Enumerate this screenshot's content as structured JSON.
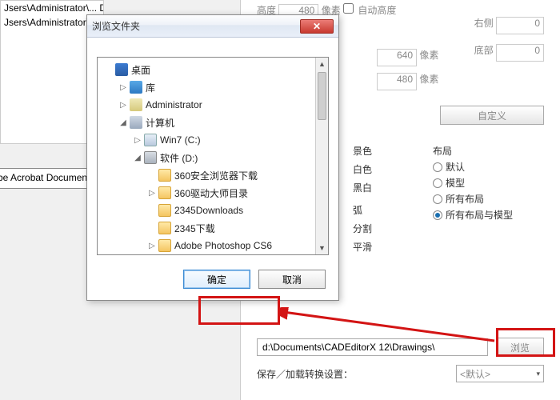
{
  "bg": {
    "pathRows": [
      "Jsers\\Administrator\\...   DWG",
      "Jsers\\Administrator\\...",
      ""
    ],
    "acrobat": "be Acrobat Documen",
    "heightLabel": "高度",
    "heightVal": "480",
    "px": "像素",
    "autoHeight": "自动高度",
    "rightLabel": "右侧",
    "rightVal": "0",
    "bottomLabel": "底部",
    "bottomVal": "0",
    "box640": "640",
    "box480": "480",
    "customBtn": "自定义",
    "colorTitle": "景色",
    "colorWhite": "白色",
    "colorBW": "黑白",
    "layoutTitle": "布局",
    "layoutDefault": "默认",
    "layoutModel": "模型",
    "layoutAll": "所有布局",
    "layoutAllModel": "所有布局与模型",
    "arcTitle": "弧",
    "arcSplit": "分割",
    "arcSmooth": "平滑",
    "outPath": "d:\\Documents\\CADEditorX 12\\Drawings\\",
    "browse": "浏览",
    "saveLoad": "保存／加载转换设置：",
    "defaultOpt": "<默认>"
  },
  "dialog": {
    "title": "浏览文件夹",
    "ok": "确定",
    "cancel": "取消",
    "tree": [
      {
        "indent": 0,
        "exp": "",
        "icon": "desktop",
        "label": "桌面"
      },
      {
        "indent": 1,
        "exp": "▷",
        "icon": "lib",
        "label": "库"
      },
      {
        "indent": 1,
        "exp": "▷",
        "icon": "user",
        "label": "Administrator"
      },
      {
        "indent": 1,
        "exp": "◢",
        "icon": "computer",
        "label": "计算机"
      },
      {
        "indent": 2,
        "exp": "▷",
        "icon": "cdrive",
        "label": "Win7 (C:)"
      },
      {
        "indent": 2,
        "exp": "◢",
        "icon": "drive",
        "label": "软件 (D:)"
      },
      {
        "indent": 3,
        "exp": "",
        "icon": "folder",
        "label": "360安全浏览器下载"
      },
      {
        "indent": 3,
        "exp": "▷",
        "icon": "folder",
        "label": "360驱动大师目录"
      },
      {
        "indent": 3,
        "exp": "",
        "icon": "folder",
        "label": "2345Downloads"
      },
      {
        "indent": 3,
        "exp": "",
        "icon": "folder",
        "label": "2345下载"
      },
      {
        "indent": 3,
        "exp": "▷",
        "icon": "folder",
        "label": "Adobe Photoshop CS6"
      }
    ]
  }
}
